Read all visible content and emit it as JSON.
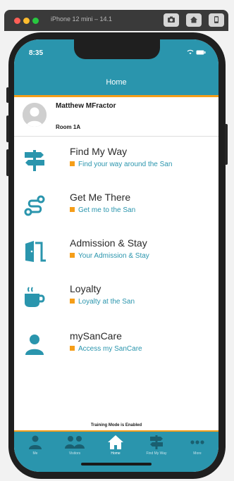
{
  "simulator": {
    "title": "iPhone 12 mini – 14.1"
  },
  "status": {
    "time": "8:35"
  },
  "header": {
    "title": "Home"
  },
  "user": {
    "name": "Matthew MFractor",
    "room": "Room 1A"
  },
  "menu": [
    {
      "title": "Find My Way",
      "subtitle": "Find your way around the San",
      "icon": "signpost-icon"
    },
    {
      "title": "Get Me There",
      "subtitle": "Get me to the San",
      "icon": "route-icon"
    },
    {
      "title": "Admission & Stay",
      "subtitle": "Your Admission & Stay",
      "icon": "door-icon"
    },
    {
      "title": "Loyalty",
      "subtitle": "Loyalty at the San",
      "icon": "coffee-cup-icon"
    },
    {
      "title": "mySanCare",
      "subtitle": "Access my SanCare",
      "icon": "person-icon"
    }
  ],
  "training_mode": "Training Mode is Enabled",
  "tabs": [
    {
      "label": "Me",
      "icon": "person-icon"
    },
    {
      "label": "Visitors",
      "icon": "people-icon"
    },
    {
      "label": "Home",
      "icon": "home-icon",
      "active": true
    },
    {
      "label": "Find My Way",
      "icon": "signpost-icon"
    },
    {
      "label": "More",
      "icon": "more-icon"
    }
  ],
  "colors": {
    "primary": "#2a95ad",
    "accent": "#f59e19",
    "text": "#2a2a2a"
  }
}
